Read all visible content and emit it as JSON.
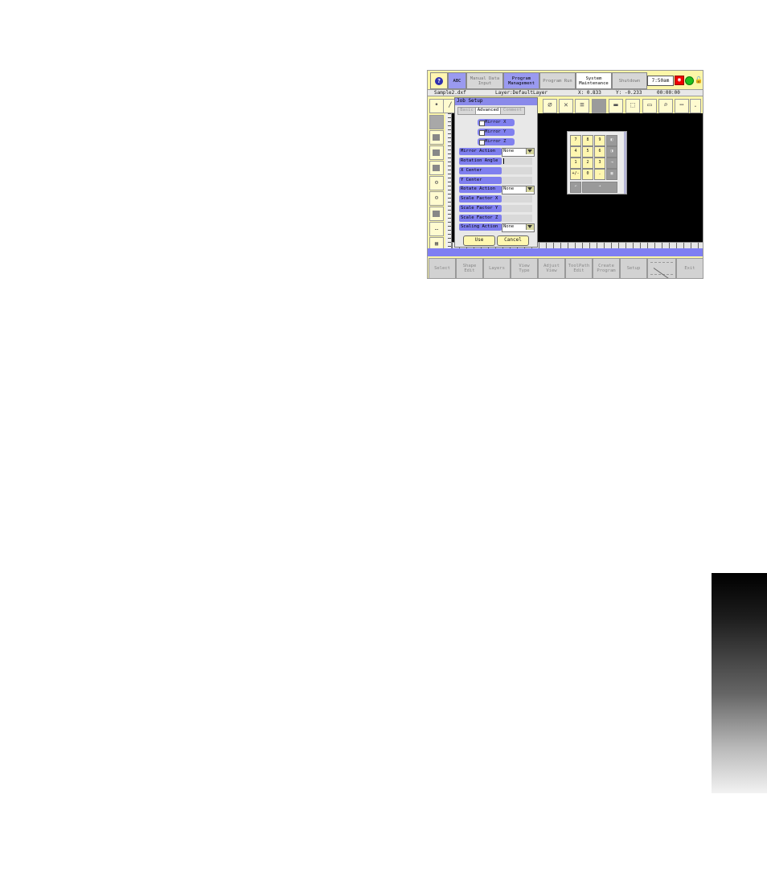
{
  "topbar": {
    "help_icon": "?",
    "abc_label": "ABC",
    "manual_data_input": [
      "Manual Data",
      "Input"
    ],
    "program_management": [
      "Program",
      "Management"
    ],
    "program_run": "Program Run",
    "system_maintenance": [
      "System",
      "Maintenance"
    ],
    "shutdown": "Shutdown",
    "time": "7:50am"
  },
  "infobar": {
    "filename": "Sample2.dxf",
    "layer": "Layer:DefaultLayer",
    "x": "X:  0.833",
    "y": "Y:  -0.233",
    "clock": "00:00:00"
  },
  "dialog": {
    "title": "Job Setup",
    "tabs": [
      "Basic",
      "Advanced",
      "Comment"
    ],
    "active_tab": "Advanced",
    "checkboxes": [
      "Mirror X",
      "Mirror Y",
      "Mirror Z"
    ],
    "fields": {
      "mirror_action": {
        "label": "Mirror Action",
        "value": "None"
      },
      "rotation_angle": {
        "label": "Rotation Angle"
      },
      "x_center": {
        "label": "X Center"
      },
      "y_center": {
        "label": "Y Center"
      },
      "rotate_action": {
        "label": "Rotate Action",
        "value": "None"
      },
      "scale_factor_x": {
        "label": "Scale Factor X"
      },
      "scale_factor_y": {
        "label": "Scale Factor Y"
      },
      "scale_factor_z": {
        "label": "Scale Factor Z"
      },
      "scaling_action": {
        "label": "Scaling Action",
        "value": "None"
      }
    },
    "use_label": "Use",
    "cancel_label": "Cancel"
  },
  "keypad": {
    "rows": [
      [
        "7",
        "8",
        "9"
      ],
      [
        "4",
        "5",
        "6"
      ],
      [
        "1",
        "2",
        "3"
      ],
      [
        "+/-",
        "0",
        "."
      ]
    ],
    "side_icons": [
      "backspace-icon",
      "clear-icon",
      "tab-icon",
      "calculator-icon"
    ],
    "bottom_icons": [
      "undo-icon",
      "enter-arrow-icon"
    ]
  },
  "bottombar": {
    "select": "Select",
    "shape_edit": [
      "Shape",
      "Edit"
    ],
    "layers": "Layers",
    "view_type": [
      "View",
      "Type"
    ],
    "adjust_view": [
      "Adjust",
      "View"
    ],
    "toolpath_edit": [
      "ToolPath",
      "Edit"
    ],
    "create_program": [
      "Create",
      "Program"
    ],
    "setup": "Setup",
    "exit": "Exit"
  },
  "colors": {
    "panel_yellow": "#fbf6a8",
    "accent_blue": "#7f7fef",
    "canvas_black": "#000000",
    "status_green": "#1fbf1f",
    "stop_red": "#e00000"
  }
}
